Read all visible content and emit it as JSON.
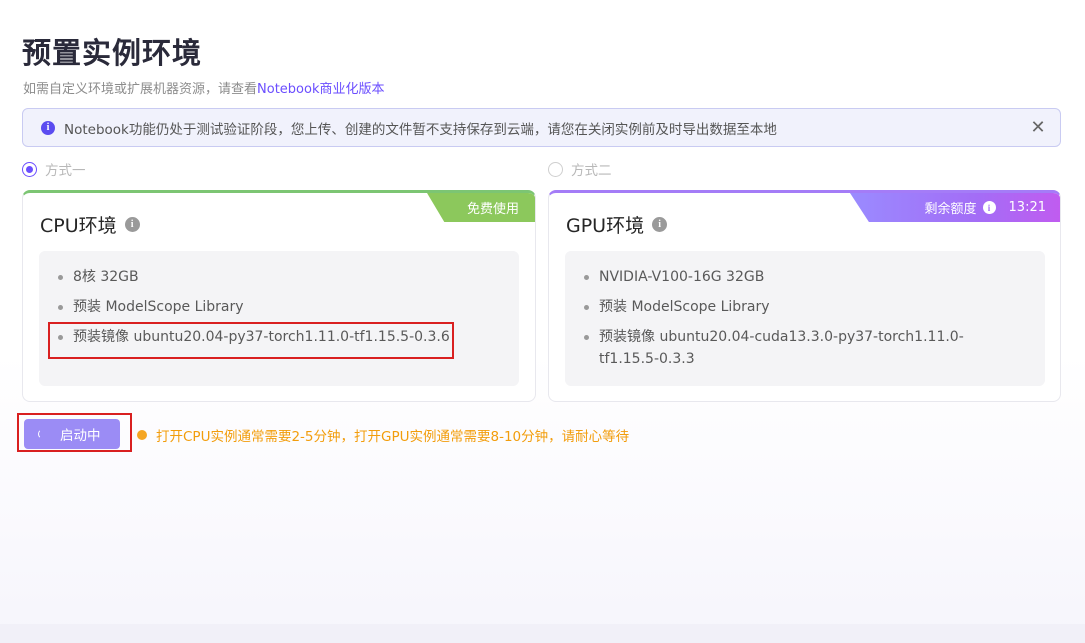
{
  "page": {
    "title": "预置实例环境",
    "subtitle_prefix": "如需自定义环境或扩展机器资源，请查看",
    "subtitle_link": "Notebook商业化版本"
  },
  "notice": {
    "text": "Notebook功能仍处于测试验证阶段，您上传、创建的文件暂不支持保存到云端，请您在关闭实例前及时导出数据至本地",
    "icon": "info-icon",
    "close_icon": "close-icon"
  },
  "options": {
    "option1": {
      "label": "方式一",
      "checked": true
    },
    "option2": {
      "label": "方式二",
      "checked": false
    }
  },
  "cpu_card": {
    "title": "CPU环境",
    "badge": "免费使用",
    "accent_color": "#7cc573",
    "specs": [
      "8核 32GB",
      "预装 ModelScope Library",
      "预装镜像 ubuntu20.04-py37-torch1.11.0-tf1.15.5-0.3.6"
    ]
  },
  "gpu_card": {
    "title": "GPU环境",
    "badge_label": "剩余额度",
    "badge_time": "13:21",
    "accent_color": "#a47cf7",
    "specs": [
      "NVIDIA-V100-16G 32GB",
      "预装 ModelScope Library",
      "预装镜像 ubuntu20.04-cuda13.3.0-py37-torch1.11.0-tf1.15.5-0.3.3"
    ]
  },
  "action": {
    "button_label": "启动中",
    "hint": "打开CPU实例通常需要2-5分钟，打开GPU实例通常需要8-10分钟，请耐心等待",
    "hint_color": "#f29d0c",
    "button_color": "#9b8cf5"
  }
}
